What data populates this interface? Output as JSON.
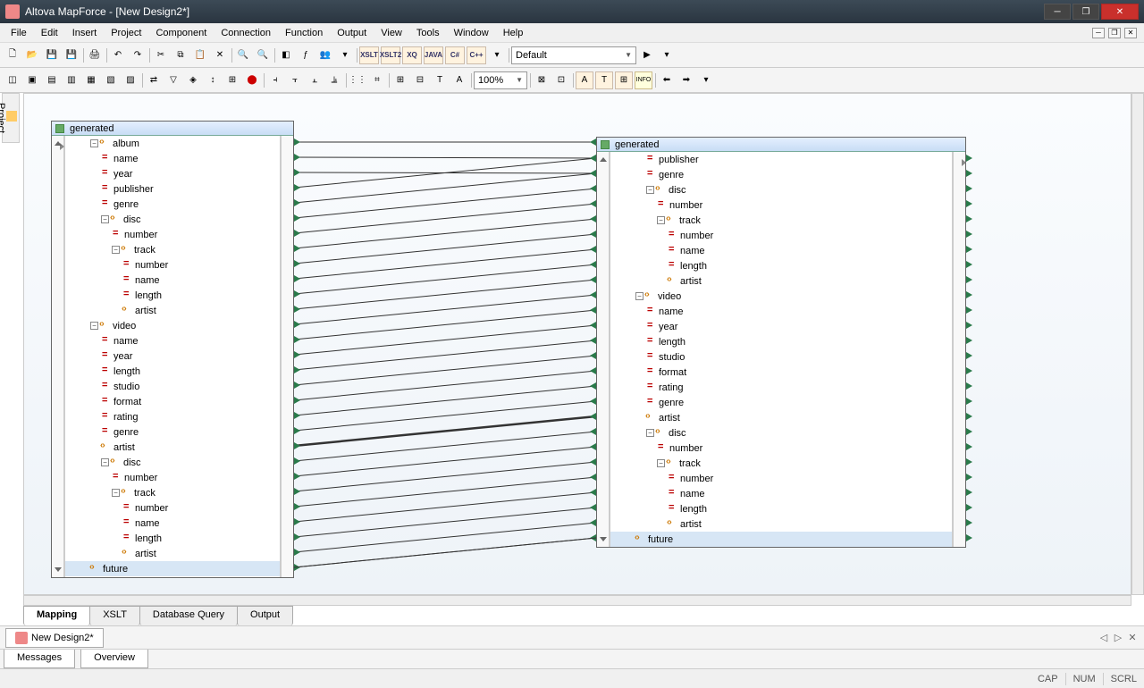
{
  "window": {
    "title": "Altova MapForce - [New Design2*]"
  },
  "menu": [
    "File",
    "Edit",
    "Insert",
    "Project",
    "Component",
    "Connection",
    "Function",
    "Output",
    "View",
    "Tools",
    "Window",
    "Help"
  ],
  "toolbar": {
    "codegen": [
      "XSLT",
      "XSLT2",
      "XQ",
      "JAVA",
      "C#",
      "C++"
    ],
    "default_select": "Default",
    "zoom": "100%"
  },
  "project_tab": "Project",
  "left_box": {
    "title": "generated",
    "rows": [
      {
        "ind": 2,
        "tog": "-",
        "ic": "elem",
        "label": "album"
      },
      {
        "ind": 3,
        "ic": "attr",
        "label": "name"
      },
      {
        "ind": 3,
        "ic": "attr",
        "label": "year"
      },
      {
        "ind": 3,
        "ic": "attr",
        "label": "publisher"
      },
      {
        "ind": 3,
        "ic": "attr",
        "label": "genre"
      },
      {
        "ind": 3,
        "tog": "-",
        "ic": "elem",
        "label": "disc"
      },
      {
        "ind": 4,
        "ic": "attr",
        "label": "number"
      },
      {
        "ind": 4,
        "tog": "-",
        "ic": "elem",
        "label": "track"
      },
      {
        "ind": 5,
        "ic": "attr",
        "label": "number"
      },
      {
        "ind": 5,
        "ic": "attr",
        "label": "name"
      },
      {
        "ind": 5,
        "ic": "attr",
        "label": "length"
      },
      {
        "ind": 5,
        "ic": "elem",
        "label": "artist"
      },
      {
        "ind": 2,
        "tog": "-",
        "ic": "elem",
        "label": "video"
      },
      {
        "ind": 3,
        "ic": "attr",
        "label": "name"
      },
      {
        "ind": 3,
        "ic": "attr",
        "label": "year"
      },
      {
        "ind": 3,
        "ic": "attr",
        "label": "length"
      },
      {
        "ind": 3,
        "ic": "attr",
        "label": "studio"
      },
      {
        "ind": 3,
        "ic": "attr",
        "label": "format"
      },
      {
        "ind": 3,
        "ic": "attr",
        "label": "rating"
      },
      {
        "ind": 3,
        "ic": "attr",
        "label": "genre"
      },
      {
        "ind": 3,
        "ic": "elem",
        "label": "artist"
      },
      {
        "ind": 3,
        "tog": "-",
        "ic": "elem",
        "label": "disc"
      },
      {
        "ind": 4,
        "ic": "attr",
        "label": "number"
      },
      {
        "ind": 4,
        "tog": "-",
        "ic": "elem",
        "label": "track"
      },
      {
        "ind": 5,
        "ic": "attr",
        "label": "number"
      },
      {
        "ind": 5,
        "ic": "attr",
        "label": "name"
      },
      {
        "ind": 5,
        "ic": "attr",
        "label": "length"
      },
      {
        "ind": 5,
        "ic": "elem",
        "label": "artist"
      },
      {
        "ind": 2,
        "ic": "elem",
        "label": "future",
        "sel": true
      }
    ]
  },
  "right_box": {
    "title": "generated",
    "rows": [
      {
        "ind": 3,
        "ic": "attr",
        "label": "publisher"
      },
      {
        "ind": 3,
        "ic": "attr",
        "label": "genre"
      },
      {
        "ind": 3,
        "tog": "-",
        "ic": "elem",
        "label": "disc"
      },
      {
        "ind": 4,
        "ic": "attr",
        "label": "number"
      },
      {
        "ind": 4,
        "tog": "-",
        "ic": "elem",
        "label": "track"
      },
      {
        "ind": 5,
        "ic": "attr",
        "label": "number"
      },
      {
        "ind": 5,
        "ic": "attr",
        "label": "name"
      },
      {
        "ind": 5,
        "ic": "attr",
        "label": "length"
      },
      {
        "ind": 5,
        "ic": "elem",
        "label": "artist"
      },
      {
        "ind": 2,
        "tog": "-",
        "ic": "elem",
        "label": "video"
      },
      {
        "ind": 3,
        "ic": "attr",
        "label": "name"
      },
      {
        "ind": 3,
        "ic": "attr",
        "label": "year"
      },
      {
        "ind": 3,
        "ic": "attr",
        "label": "length"
      },
      {
        "ind": 3,
        "ic": "attr",
        "label": "studio"
      },
      {
        "ind": 3,
        "ic": "attr",
        "label": "format"
      },
      {
        "ind": 3,
        "ic": "attr",
        "label": "rating"
      },
      {
        "ind": 3,
        "ic": "attr",
        "label": "genre"
      },
      {
        "ind": 3,
        "ic": "elem",
        "label": "artist"
      },
      {
        "ind": 3,
        "tog": "-",
        "ic": "elem",
        "label": "disc"
      },
      {
        "ind": 4,
        "ic": "attr",
        "label": "number"
      },
      {
        "ind": 4,
        "tog": "-",
        "ic": "elem",
        "label": "track"
      },
      {
        "ind": 5,
        "ic": "attr",
        "label": "number"
      },
      {
        "ind": 5,
        "ic": "attr",
        "label": "name"
      },
      {
        "ind": 5,
        "ic": "attr",
        "label": "length"
      },
      {
        "ind": 5,
        "ic": "elem",
        "label": "artist"
      },
      {
        "ind": 2,
        "ic": "elem",
        "label": "future",
        "sel": true
      }
    ]
  },
  "bottom_tabs": [
    "Mapping",
    "XSLT",
    "Database Query",
    "Output"
  ],
  "bottom_active": 0,
  "doc_tab": "New Design2*",
  "msg_tabs": [
    "Messages",
    "Overview"
  ],
  "status": [
    "CAP",
    "NUM",
    "SCRL"
  ]
}
